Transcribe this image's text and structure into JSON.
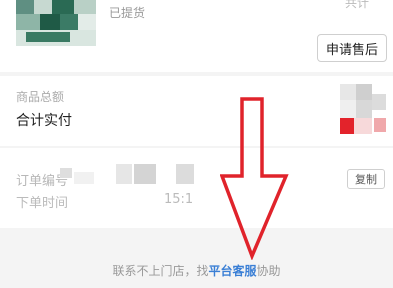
{
  "product": {
    "status_text": "已提货",
    "corner_text": "共计",
    "after_sale_button": "申请售后"
  },
  "summary": {
    "goods_total_label": "商品总额",
    "paid_label": "合计实付"
  },
  "order": {
    "order_no_label": "订单编号",
    "order_time_label": "下单时间",
    "order_time_value": "15:1",
    "copy_button": "复制"
  },
  "footer": {
    "text_before": "联系不上门店，找",
    "link_text": "平台客服",
    "text_after": "协助"
  },
  "colors": {
    "link": "#3a7fd5",
    "annotation_arrow": "#e0232b"
  }
}
